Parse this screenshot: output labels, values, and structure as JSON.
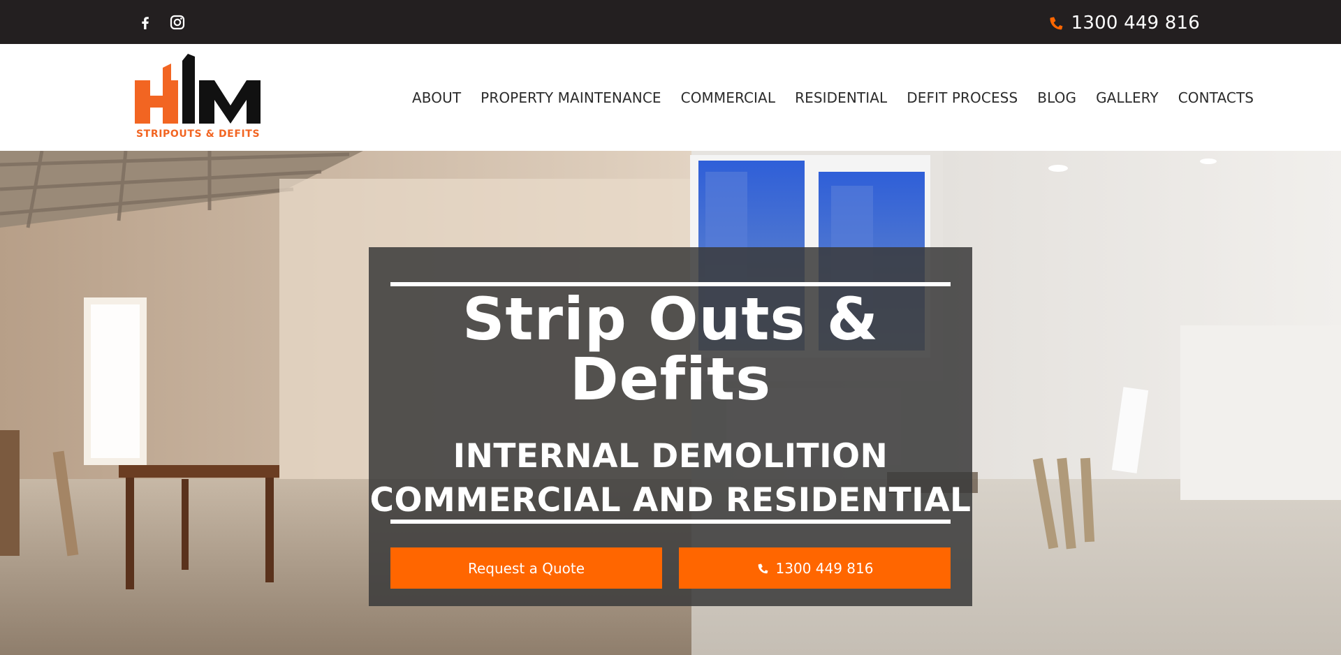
{
  "topbar": {
    "social": [
      {
        "name": "facebook-icon"
      },
      {
        "name": "instagram-icon"
      }
    ],
    "phone_icon": "phone-icon",
    "phone": "1300 449 816"
  },
  "header": {
    "logo": {
      "brand": "HM",
      "tagline": "STRIPOUTS & DEFITS"
    },
    "nav": [
      {
        "label": "ABOUT"
      },
      {
        "label": "PROPERTY MAINTENANCE"
      },
      {
        "label": "COMMERCIAL"
      },
      {
        "label": "RESIDENTIAL"
      },
      {
        "label": "DEFIT PROCESS"
      },
      {
        "label": "BLOG"
      },
      {
        "label": "GALLERY"
      },
      {
        "label": "CONTACTS"
      }
    ]
  },
  "hero": {
    "title_line1": "Strip Outs &",
    "title_line2": "Defits",
    "subtitle_line1": "INTERNAL DEMOLITION",
    "subtitle_line2": "COMMERCIAL AND RESIDENTIAL",
    "quote_button": "Request a Quote",
    "call_button": "1300 449 816"
  },
  "colors": {
    "accent": "#ff6600",
    "topbar_bg": "#231f20",
    "card_bg": "#3a3a3a"
  }
}
